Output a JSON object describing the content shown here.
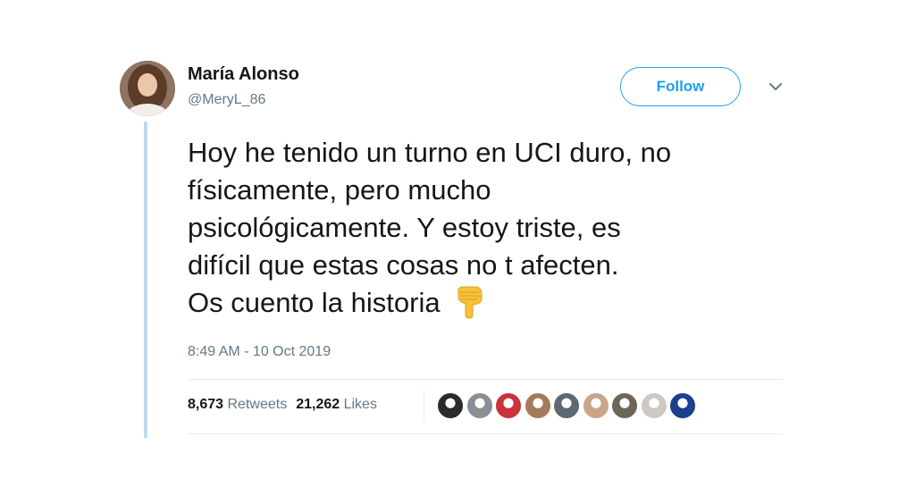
{
  "user": {
    "display_name": "María Alonso",
    "handle": "@MeryL_86",
    "avatar_icon": "profile-photo"
  },
  "header": {
    "follow_label": "Follow",
    "menu_icon": "chevron-down-icon"
  },
  "tweet": {
    "lines": [
      "Hoy he tenido un turno en UCI duro, no",
      "físicamente, pero mucho",
      "psicológicamente. Y estoy triste, es",
      "difícil que estas cosas no t afecten.",
      "Os cuento la historia"
    ],
    "emoji": "backhand-index-pointing-down",
    "timestamp": "8:49 AM - 10 Oct 2019"
  },
  "stats": {
    "retweets_count": "8,673",
    "retweets_label": "Retweets",
    "likes_count": "21,262",
    "likes_label": "Likes"
  },
  "likers": [
    {
      "name": "liker-avatar-1",
      "color": "#2b2b2b"
    },
    {
      "name": "liker-avatar-2",
      "color": "#8a8f97"
    },
    {
      "name": "liker-avatar-3",
      "color": "#c8343a"
    },
    {
      "name": "liker-avatar-4",
      "color": "#a57a5a"
    },
    {
      "name": "liker-avatar-5",
      "color": "#5d6870"
    },
    {
      "name": "liker-avatar-6",
      "color": "#c9a58a"
    },
    {
      "name": "liker-avatar-7",
      "color": "#6f6658"
    },
    {
      "name": "liker-avatar-8",
      "color": "#cfc9c2"
    },
    {
      "name": "liker-avatar-9",
      "color": "#1c3f8f"
    }
  ],
  "colors": {
    "accent": "#1da1f2",
    "thread_line": "#bfd9ea",
    "secondary_text": "#657786"
  }
}
